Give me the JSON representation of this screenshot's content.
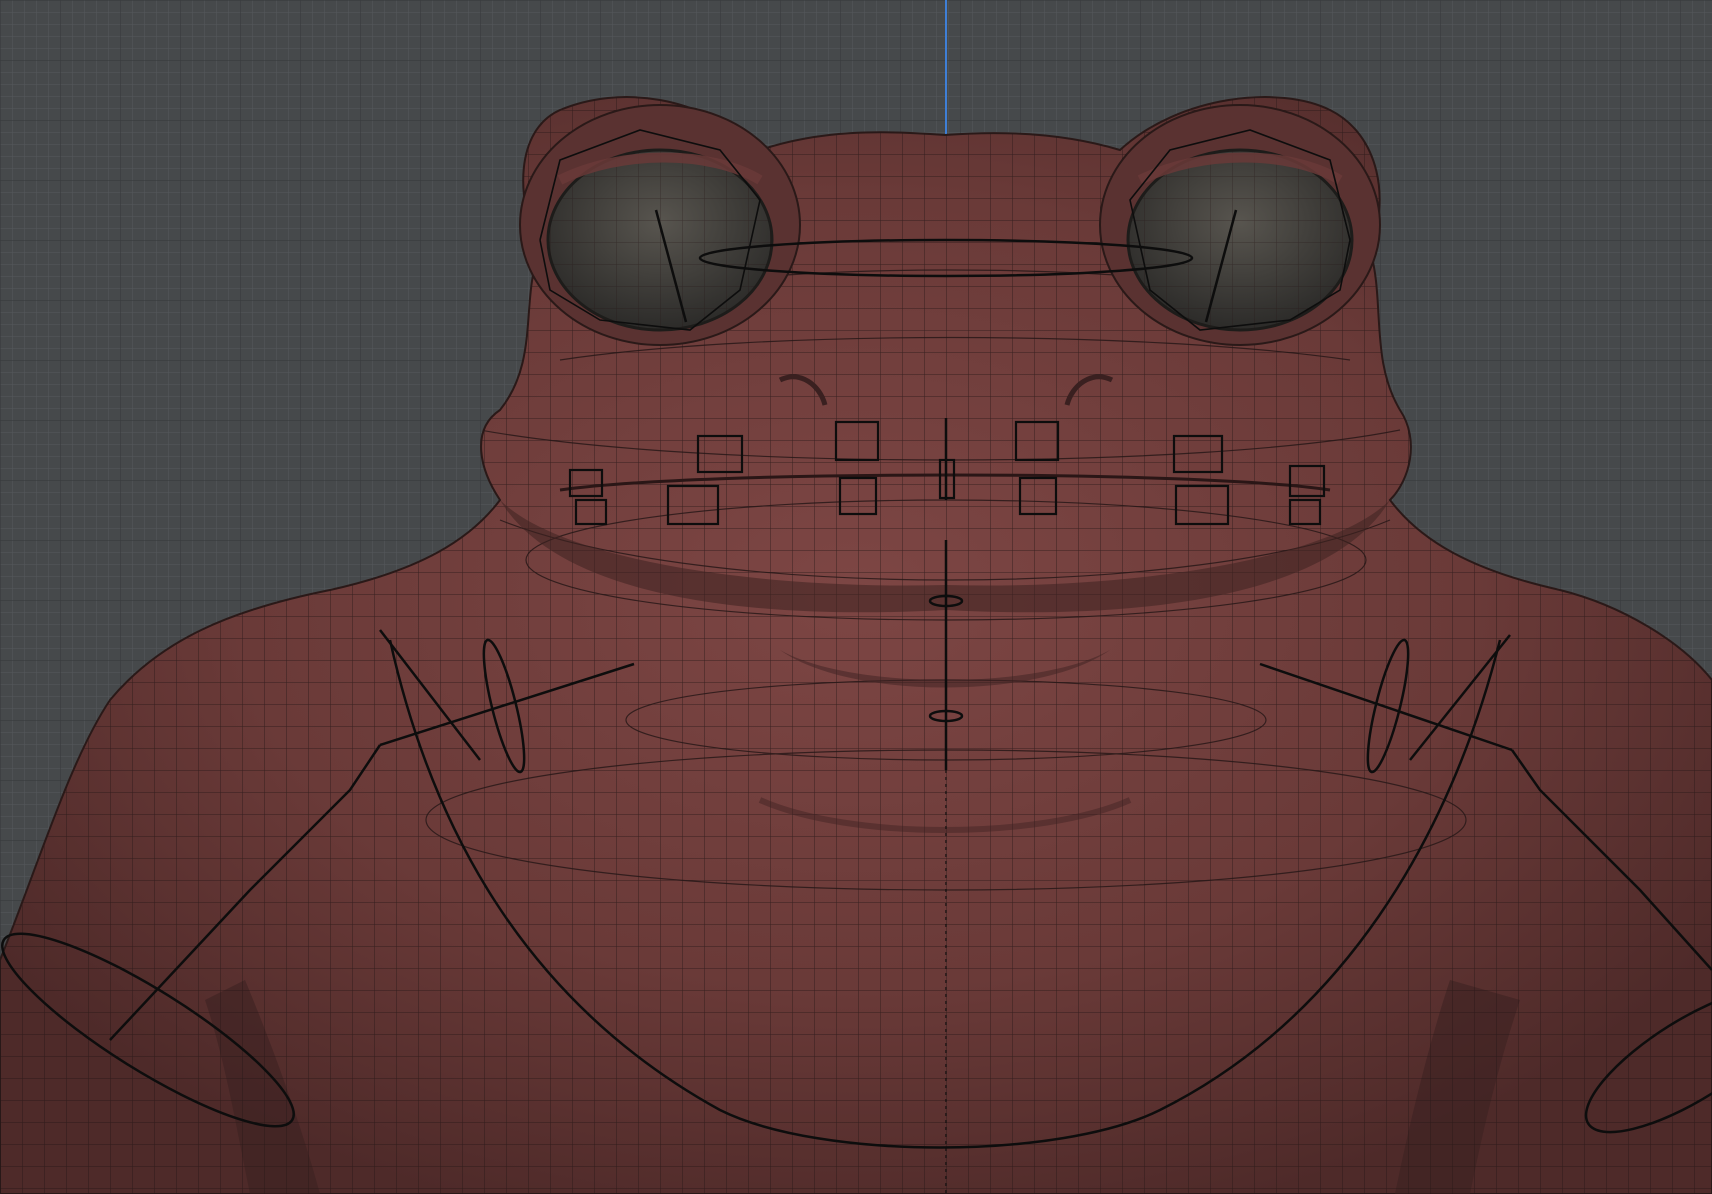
{
  "app": {
    "window_title": "",
    "view": "front-orthographic",
    "background_color": "#444749",
    "grid_color_minor": "#55595c",
    "grid_color_major": "#2f3234",
    "axis_color": "#3f7fd6"
  },
  "model": {
    "name": "",
    "subject": "frog-character-bust",
    "skin_color": "#6a3a38",
    "skin_highlight": "#8a5250",
    "wire_color": "#221616",
    "eye_color": "#3b3a37"
  },
  "rig": {
    "control_color": "#0d0d0d",
    "controls": [
      "head-ring-control",
      "eye-aim-control-left",
      "eye-aim-control-right",
      "mouth-box-controls",
      "jaw-pivot-control",
      "clavicle-control-left",
      "clavicle-control-right",
      "shoulder-ring-control-left",
      "shoulder-ring-control-right",
      "arm-ring-control-left",
      "arm-ring-control-right",
      "chest-curve-control",
      "neck-pivot-control"
    ]
  }
}
